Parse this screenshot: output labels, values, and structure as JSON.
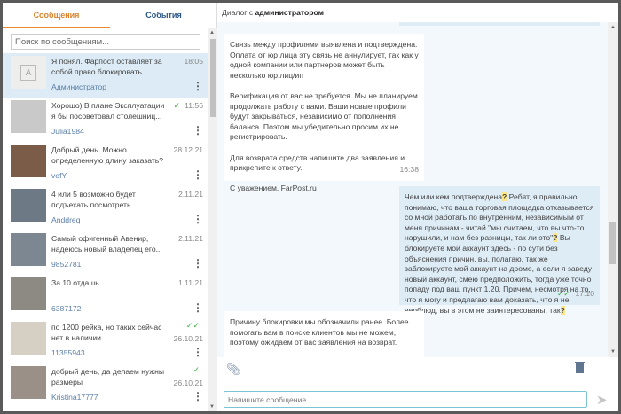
{
  "tabs": {
    "messages": "Сообщения",
    "events": "События"
  },
  "search": {
    "placeholder": "Поиск по сообщениям..."
  },
  "conversations": [
    {
      "text": "Я понял. Фарпост оставляет за собой право блокировать...",
      "time": "18:05",
      "user": "Администратор",
      "avatar_letter": "A",
      "status": ""
    },
    {
      "text": "Хорошо) В плане Эксплуатации я бы посоветовал столешниц...",
      "time": "11:56",
      "user": "Julia1984",
      "status": "✓"
    },
    {
      "text": "Добрый день. Можно определенную длину заказать?",
      "time": "28.12.21",
      "user": "vefY",
      "status": ""
    },
    {
      "text": "4 или 5 возможно будет подъехать посмотреть",
      "time": "2.11.21",
      "user": "Anddreq",
      "status": ""
    },
    {
      "text": "Самый офигенный Авенир, надеюсь новый владелец его...",
      "time": "2.11.21",
      "user": "9852781",
      "status": ""
    },
    {
      "text": "За 10 отдашь",
      "time": "1.11.21",
      "user": "6387172",
      "status": ""
    },
    {
      "text": "по 1200 рейка, но таких сейчас нет в наличии",
      "time": "26.10.21",
      "user": "11355943",
      "status": "✓✓"
    },
    {
      "text": "добрый день, да делаем нужны размеры",
      "time": "26.10.21",
      "user": "Kristina17777",
      "status": "✓"
    }
  ],
  "dialog": {
    "prefix": "Диалог с ",
    "name": "администратором"
  },
  "messages": [
    {
      "paragraphs": [
        "Связь между профилями выявлена и подтверждена. Оплата от юр лица эту связь не аннулирует, так как у одной компании или партнеров может быть несколько юр.лиц/ип",
        "Верификация от вас не требуется. Мы не планируем продолжать работу с вами. Ваши новые профили будут закрываться, независимо от пополнения баланса. Поэтом мы убедительно просим их не регистрировать.",
        "Для возврата средств напишите два заявления и прикрепите к ответу.",
        "С уважением, FarPost.ru"
      ],
      "time": "16:38"
    },
    {
      "parts": [
        "Чем или кем подтверждена",
        "?",
        " Ребят, я правильно понимаю, что ваша торговая площадка отказывается со мной работать по внутренним, независимым от меня причинам - читай \"мы считаем, что вы что-то нарушили, и нам без разницы, так ли это\"",
        "?",
        " Вы блокируете мой аккаунт здесь - по сути без объяснения причин, вы, полагаю, так же заблокируете мой аккаунт на дроме, а если я заведу новый аккаунт, смею предположить, тогда уже точно попаду под ваш пункт 1.20. Причем, несмотря на то, что я могу и предлагаю вам доказать, что я не верблюд, вы в этом не заинтересованы, так",
        "?"
      ],
      "time": "17:10",
      "status": "✓✓"
    },
    {
      "paragraphs": [
        "Причину блокировки мы обозначили ранее. Более помогать вам в поиске клиентов мы не можем, поэтому ожидаем от вас заявления на возврат."
      ]
    }
  ],
  "composer": {
    "placeholder": "Напишите сообщение..."
  },
  "colors": {
    "accent": "#e8892f",
    "link": "#2a5485",
    "selected": "#dcebf5",
    "chat_bg": "#f2f8fc",
    "outgoing": "#deecf6"
  }
}
